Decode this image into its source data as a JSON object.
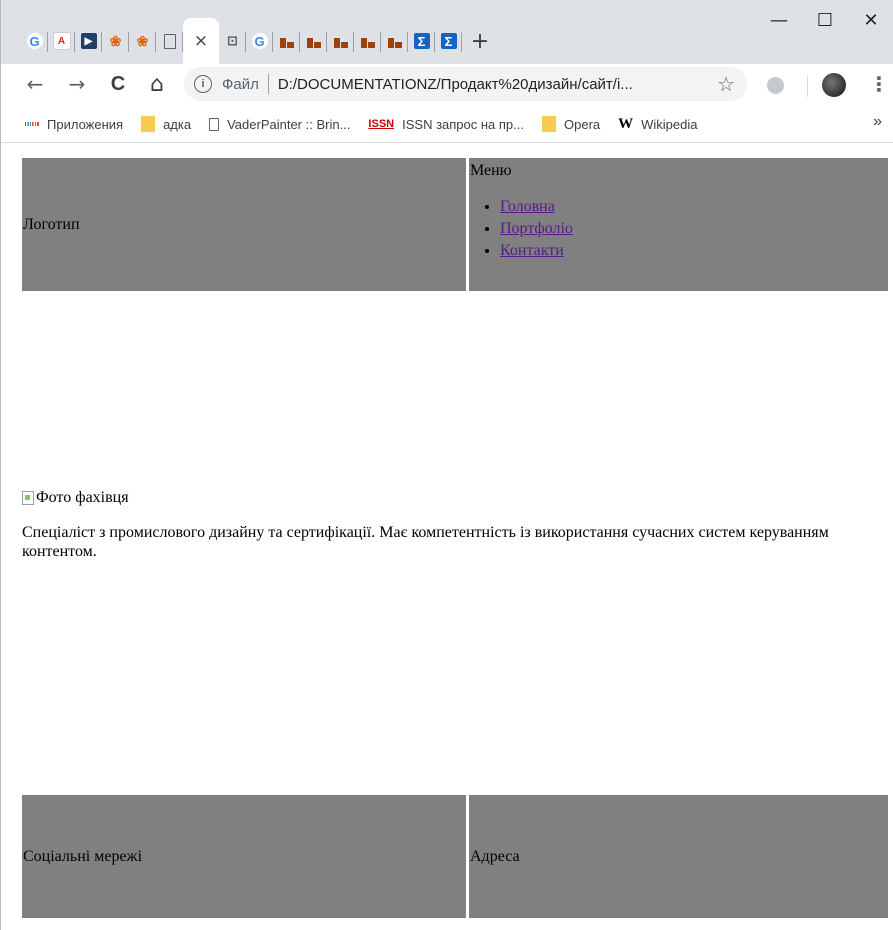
{
  "browser": {
    "tabs": [
      {
        "icon": "google-icon",
        "glyph": "G"
      },
      {
        "icon": "adobe-icon",
        "glyph": "A"
      },
      {
        "icon": "presentation-icon",
        "glyph": "▶"
      },
      {
        "icon": "paw-icon",
        "glyph": "❀"
      },
      {
        "icon": "paw-icon",
        "glyph": "❀"
      },
      {
        "icon": "blank-page-icon",
        "glyph": ""
      },
      {
        "icon": "extension-icon",
        "glyph": "⊡"
      },
      {
        "icon": "google-icon",
        "glyph": "G"
      },
      {
        "icon": "brick-icon",
        "glyph": ""
      },
      {
        "icon": "brick-icon",
        "glyph": ""
      },
      {
        "icon": "brick-icon",
        "glyph": ""
      },
      {
        "icon": "brick-icon",
        "glyph": ""
      },
      {
        "icon": "brick-icon",
        "glyph": ""
      },
      {
        "icon": "sigma-icon",
        "glyph": "Σ"
      },
      {
        "icon": "sigma-icon",
        "glyph": "Σ"
      }
    ],
    "new_tab_glyph": "+",
    "close_tab_glyph": "×",
    "window_controls": {
      "minimize": "—",
      "maximize": "☐",
      "close": "✕"
    },
    "nav": {
      "back": "←",
      "forward": "→",
      "reload": "C",
      "home": "⌂"
    },
    "address": {
      "info_glyph": "i",
      "scheme_label": "Файл",
      "url": "D:/DOCUMENTATIONZ/Продакт%20дизайн/сайт/i...",
      "star_glyph": "☆"
    },
    "menu_glyph": "⋮",
    "bookmarks": [
      {
        "label": "Приложения",
        "icon": "apps-icon"
      },
      {
        "label": "адка",
        "icon": "folder-icon"
      },
      {
        "label": "VaderPainter :: Brin...",
        "icon": "page-icon"
      },
      {
        "label": "ISSN запрос на пр...",
        "icon": "issn-icon",
        "glyph": "ISSN"
      },
      {
        "label": "Opera",
        "icon": "folder-icon"
      },
      {
        "label": "Wikipedia",
        "icon": "wikipedia-icon",
        "glyph": "W"
      }
    ],
    "bookmarks_more": "»"
  },
  "page": {
    "header": {
      "logo": "Логотип",
      "menu_title": "Меню",
      "menu_items": [
        "Головна",
        "Портфоліо",
        "Контакти"
      ]
    },
    "main": {
      "photo_alt": "Фото фахівця",
      "description": "Спеціаліст з промислового дизайну та сертифікації. Має компетентність із використання сучасних систем керуванням контентом."
    },
    "footer": {
      "social": "Соціальні мережі",
      "address": "Адреса"
    }
  },
  "colors": {
    "cell_bg": "#808080",
    "link_visited": "#551a8b",
    "tabstrip_bg": "#dee1e6"
  }
}
